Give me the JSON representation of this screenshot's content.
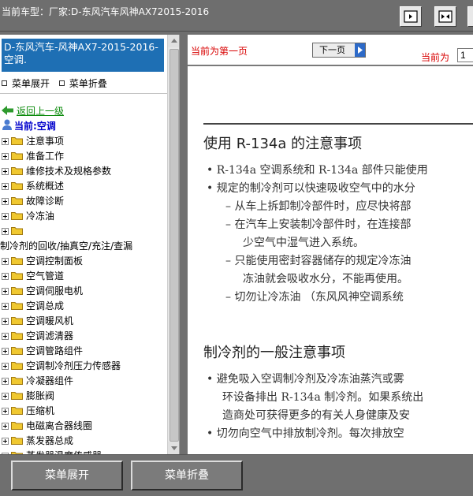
{
  "header": {
    "title": "当前车型：厂家:D-东风汽车风神AX72015-2016"
  },
  "sidebar": {
    "car_title": "D-东风汽车-风神AX7-2015-2016- 空调.",
    "expand_label": "菜单展开",
    "collapse_label": "菜单折叠",
    "back_label": "返回上一级",
    "current_label": "当前:空调",
    "items_a": [
      "注意事项",
      "准备工作",
      "维修技术及规格参数",
      "系统概述",
      "故障诊断",
      "冷冻油",
      ""
    ],
    "overflow_item": "制冷剂的回收/抽真空/充注/查漏",
    "items_b": [
      "空调控制面板",
      "空气管道",
      "空调伺服电机",
      "空调总成",
      "空调暖风机",
      "空调滤清器",
      "空调管路组件",
      "空调制冷剂压力传感器",
      "冷凝器组件",
      "膨胀阀",
      "压缩机",
      "电磁离合器线圈",
      "蒸发器总成",
      "蒸发器温度传感器"
    ]
  },
  "nav": {
    "page_info": "当前为第一页",
    "next_label": "下一页",
    "current_label": "当前为",
    "page_value": "1"
  },
  "document": {
    "heading1": "使用 R-134a 的注意事项",
    "lines1": [
      "• R-134a 空调系统和 R-134a 部件只能使用",
      "• 规定的制冷剂可以快速吸收空气中的水分",
      "– 从车上拆卸制冷部件时，应尽快将部",
      "– 在汽车上安装制冷部件时，在连接部",
      "少空气中湿气进入系统。",
      "– 只能使用密封容器储存的规定冷冻油",
      "冻油就会吸收水分，不能再使用。",
      "– 切勿让冷冻油 （东风风神空调系统"
    ],
    "heading2": "制冷剂的一般注意事项",
    "lines2": [
      "• 避免吸入空调制冷剂及冷冻油蒸汽或雾",
      "环设备排出 R-134a 制冷剂。如果系统出",
      "造商处可获得更多的有关人身健康及安",
      "• 切勿向空气中排放制冷剂。每次排放空"
    ]
  },
  "footer": {
    "expand_label": "菜单展开",
    "collapse_label": "菜单折叠"
  },
  "colors": {
    "accent_blue": "#1e6fb4",
    "link_green": "#0a8a0a",
    "page_red": "#d80000",
    "folder_yellow": "#f0c830"
  }
}
